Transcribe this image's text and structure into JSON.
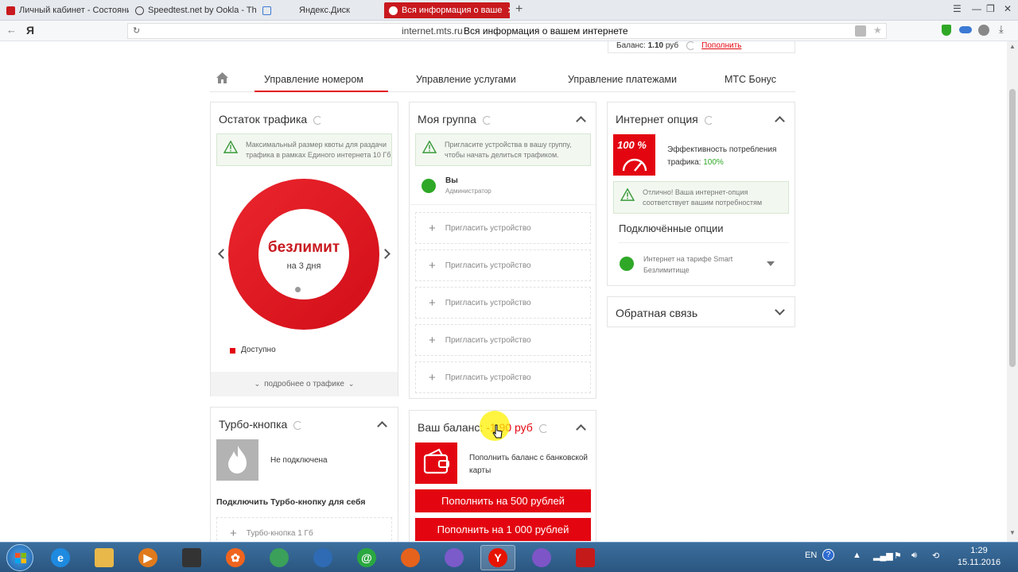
{
  "tabs": [
    {
      "label": "Личный кабинет - Состояни",
      "color": "#c8191e"
    },
    {
      "label": "Speedtest.net by Ookla - Th",
      "color": "#444444"
    },
    {
      "label": "Яндекс.Диск",
      "color": "#3b7ad4"
    },
    {
      "label": "Вся информация о ваше",
      "color": "#ffffff"
    }
  ],
  "address": {
    "domain": "internet.mts.ru",
    "title": "Вся информация о вашем интернете",
    "yandex": "Я"
  },
  "header": {
    "balance_label": "Баланс:",
    "balance_value": "1.10",
    "balance_unit": "руб",
    "topup": "Пополнить"
  },
  "nav": {
    "items": [
      "Управление номером",
      "Управление услугами",
      "Управление платежами",
      "МТС Бонус"
    ]
  },
  "traffic": {
    "title": "Остаток трафика",
    "notice": [
      "Максимальный размер квоты для раздачи",
      "трафика в рамках Единого интернета 10 Гб"
    ],
    "center_big": "безлимит",
    "center_small": "на 3 дня",
    "legend": "Доступно",
    "more": "подробнее о трафике"
  },
  "group": {
    "title": "Моя группа",
    "notice": [
      "Пригласите устройства в вашу группу,",
      "чтобы начать делиться трафиком."
    ],
    "member_name": "Вы",
    "member_role": "Администратор",
    "invite_label": "Пригласить устройство",
    "invite_count": 5
  },
  "internet_option": {
    "title": "Интернет опция",
    "percent_badge": "100 %",
    "efficiency_label": "Эффективность потребления",
    "efficiency_label2": "трафика:",
    "efficiency_value": "100%",
    "notice": [
      "Отлично! Ваша интернет-опция",
      "соответствует вашим потребностям"
    ],
    "connected_title": "Подключённые опции",
    "connected_item": [
      "Интернет на тарифе Smart",
      "Безлимитище"
    ]
  },
  "feedback": {
    "title": "Обратная связь"
  },
  "turbo": {
    "title": "Турбо-кнопка",
    "status": "Не подключена",
    "connect_title": "Подключить Турбо-кнопку для себя",
    "item": "Турбо-кнопка 1 Гб"
  },
  "balance_card": {
    "title": "Ваш баланс:",
    "value": "-1,90 руб",
    "card_text": [
      "Пополнить баланс с банковской",
      "карты"
    ],
    "btn_500": "Пополнить на 500 рублей",
    "btn_1000": "Пополнить на 1 000 рублей"
  },
  "colors": {
    "brand_red": "#e30611",
    "green": "#2fa827"
  },
  "taskbar": {
    "apps": [
      {
        "name": "ie",
        "glyph": "e",
        "color": "#1e8ae0"
      },
      {
        "name": "explorer",
        "glyph": "",
        "color": "#e8b84a"
      },
      {
        "name": "media",
        "glyph": "▶",
        "color": "#e07a1c"
      },
      {
        "name": "taskmgr",
        "glyph": "",
        "color": "#333333"
      },
      {
        "name": "app-orange",
        "glyph": "✿",
        "color": "#f0641e"
      },
      {
        "name": "chrome",
        "glyph": "",
        "color": "#3aa05a"
      },
      {
        "name": "thunderbird",
        "glyph": "",
        "color": "#2e6bb4"
      },
      {
        "name": "mail-at",
        "glyph": "@",
        "color": "#2aa840"
      },
      {
        "name": "firefox",
        "glyph": "",
        "color": "#e5621c"
      },
      {
        "name": "app-purple",
        "glyph": "",
        "color": "#7a5bc9"
      },
      {
        "name": "yandex",
        "glyph": "Y",
        "color": "#e61400"
      },
      {
        "name": "viber",
        "glyph": "",
        "color": "#7d55c7"
      },
      {
        "name": "pdf",
        "glyph": "",
        "color": "#c51a1a"
      }
    ],
    "lang": "EN",
    "time": "1:29",
    "date": "15.11.2016"
  }
}
